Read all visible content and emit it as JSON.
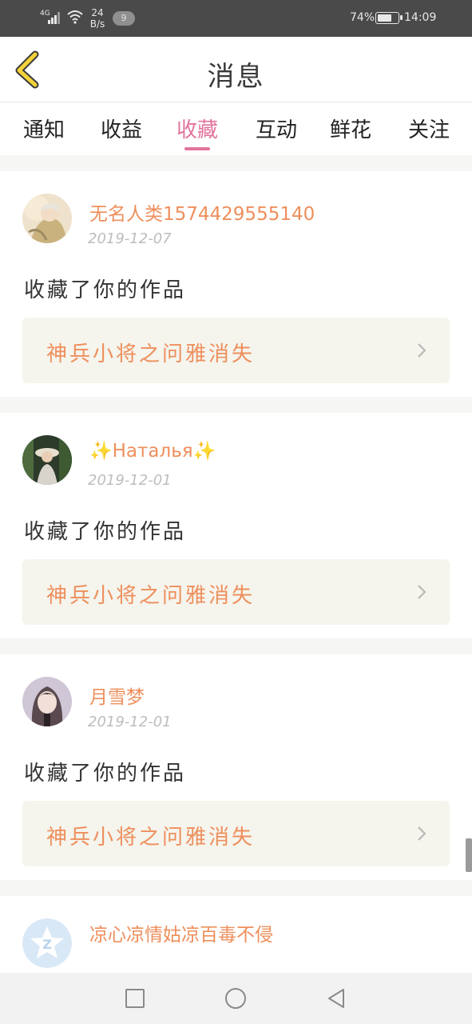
{
  "status_bar": {
    "network": "4G",
    "speed_value": "24",
    "speed_unit": "B/s",
    "notification_count": "9",
    "battery_percent": "74%",
    "battery_level": 0.74,
    "time": "14:09"
  },
  "header": {
    "title": "消息"
  },
  "tabs": [
    {
      "label": "通知",
      "active": false
    },
    {
      "label": "收益",
      "active": false
    },
    {
      "label": "收藏",
      "active": true
    },
    {
      "label": "互动",
      "active": false
    },
    {
      "label": "鲜花",
      "active": false
    },
    {
      "label": "关注",
      "active": false
    }
  ],
  "messages": [
    {
      "username": "无名人类1574429555140",
      "date": "2019-12-07",
      "action": "收藏了你的作品",
      "work_title": "神兵小将之问雅消失"
    },
    {
      "username_sparkle_left": "✨",
      "username": "Наталья",
      "username_sparkle_right": "✨",
      "date": "2019-12-01",
      "action": "收藏了你的作品",
      "work_title": "神兵小将之问雅消失"
    },
    {
      "username": "月雪梦",
      "date": "2019-12-01",
      "action": "收藏了你的作品",
      "work_title": "神兵小将之问雅消失"
    },
    {
      "username": "凉心凉情姑凉百毒不侵"
    }
  ],
  "colors": {
    "accent": "#e2739c",
    "username": "#ee8f5c",
    "date": "#bdbdbd",
    "work_box_bg": "#f5f4ed",
    "back_arrow": "#f3d23a"
  },
  "icons": {
    "back": "chevron-left-icon",
    "work_arrow": "chevron-right-icon",
    "nav_recent": "square-icon",
    "nav_home": "circle-icon",
    "nav_back": "triangle-back-icon"
  }
}
